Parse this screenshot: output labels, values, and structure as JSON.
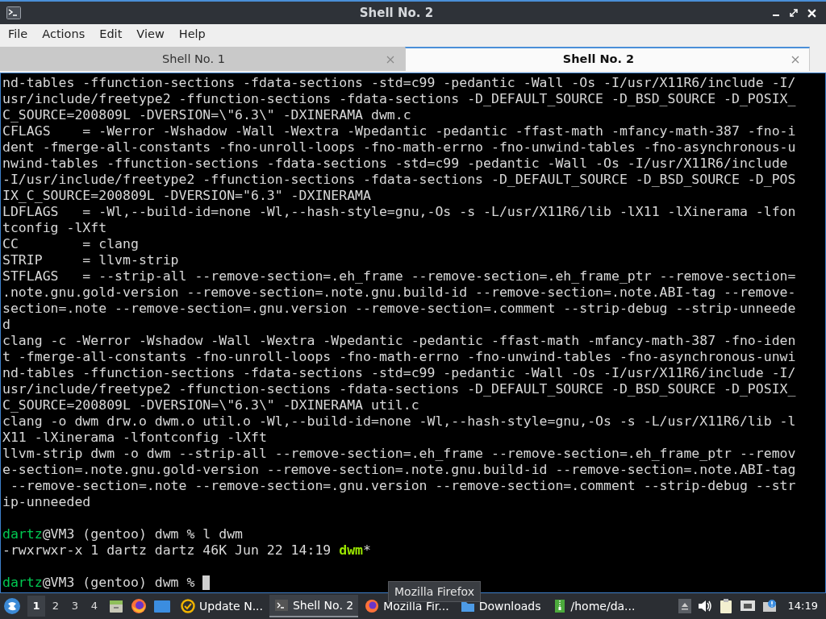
{
  "window": {
    "title": "Shell No. 2"
  },
  "menu": [
    "File",
    "Actions",
    "Edit",
    "View",
    "Help"
  ],
  "tabs": [
    {
      "label": "Shell No. 1",
      "selected": false
    },
    {
      "label": "Shell No. 2",
      "selected": true
    }
  ],
  "terminal": {
    "lines": [
      {
        "kind": "text",
        "segments": [
          {
            "kind": "plain",
            "text": "nd-tables -ffunction-sections -fdata-sections -std=c99 -pedantic -Wall -Os -I/usr/X11R6/include -I/"
          }
        ]
      },
      {
        "kind": "text",
        "segments": [
          {
            "kind": "plain",
            "text": "usr/include/freetype2 -ffunction-sections -fdata-sections -D_DEFAULT_SOURCE -D_BSD_SOURCE -D_POSIX_"
          }
        ]
      },
      {
        "kind": "text",
        "segments": [
          {
            "kind": "plain",
            "text": "C_SOURCE=200809L -DVERSION=\\\"6.3\\\" -DXINERAMA dwm.c"
          }
        ]
      },
      {
        "kind": "text",
        "segments": [
          {
            "kind": "plain",
            "text": "CFLAGS    = -Werror -Wshadow -Wall -Wextra -Wpedantic -pedantic -ffast-math -mfancy-math-387 -fno-i"
          }
        ]
      },
      {
        "kind": "text",
        "segments": [
          {
            "kind": "plain",
            "text": "dent -fmerge-all-constants -fno-unroll-loops -fno-math-errno -fno-unwind-tables -fno-asynchronous-u"
          }
        ]
      },
      {
        "kind": "text",
        "segments": [
          {
            "kind": "plain",
            "text": "nwind-tables -ffunction-sections -fdata-sections -std=c99 -pedantic -Wall -Os -I/usr/X11R6/include"
          }
        ]
      },
      {
        "kind": "text",
        "segments": [
          {
            "kind": "plain",
            "text": "-I/usr/include/freetype2 -ffunction-sections -fdata-sections -D_DEFAULT_SOURCE -D_BSD_SOURCE -D_POS"
          }
        ]
      },
      {
        "kind": "text",
        "segments": [
          {
            "kind": "plain",
            "text": "IX_C_SOURCE=200809L -DVERSION=\"6.3\" -DXINERAMA"
          }
        ]
      },
      {
        "kind": "text",
        "segments": [
          {
            "kind": "plain",
            "text": "LDFLAGS   = -Wl,--build-id=none -Wl,--hash-style=gnu,-Os -s -L/usr/X11R6/lib -lX11 -lXinerama -lfon"
          }
        ]
      },
      {
        "kind": "text",
        "segments": [
          {
            "kind": "plain",
            "text": "tconfig -lXft"
          }
        ]
      },
      {
        "kind": "text",
        "segments": [
          {
            "kind": "plain",
            "text": "CC        = clang"
          }
        ]
      },
      {
        "kind": "text",
        "segments": [
          {
            "kind": "plain",
            "text": "STRIP     = llvm-strip"
          }
        ]
      },
      {
        "kind": "text",
        "segments": [
          {
            "kind": "plain",
            "text": "STFLAGS   = --strip-all --remove-section=.eh_frame --remove-section=.eh_frame_ptr --remove-section="
          }
        ]
      },
      {
        "kind": "text",
        "segments": [
          {
            "kind": "plain",
            "text": ".note.gnu.gold-version --remove-section=.note.gnu.build-id --remove-section=.note.ABI-tag --remove-"
          }
        ]
      },
      {
        "kind": "text",
        "segments": [
          {
            "kind": "plain",
            "text": "section=.note --remove-section=.gnu.version --remove-section=.comment --strip-debug --strip-unneede"
          }
        ]
      },
      {
        "kind": "text",
        "segments": [
          {
            "kind": "plain",
            "text": "d"
          }
        ]
      },
      {
        "kind": "text",
        "segments": [
          {
            "kind": "plain",
            "text": "clang -c -Werror -Wshadow -Wall -Wextra -Wpedantic -pedantic -ffast-math -mfancy-math-387 -fno-iden"
          }
        ]
      },
      {
        "kind": "text",
        "segments": [
          {
            "kind": "plain",
            "text": "t -fmerge-all-constants -fno-unroll-loops -fno-math-errno -fno-unwind-tables -fno-asynchronous-unwi"
          }
        ]
      },
      {
        "kind": "text",
        "segments": [
          {
            "kind": "plain",
            "text": "nd-tables -ffunction-sections -fdata-sections -std=c99 -pedantic -Wall -Os -I/usr/X11R6/include -I/"
          }
        ]
      },
      {
        "kind": "text",
        "segments": [
          {
            "kind": "plain",
            "text": "usr/include/freetype2 -ffunction-sections -fdata-sections -D_DEFAULT_SOURCE -D_BSD_SOURCE -D_POSIX_"
          }
        ]
      },
      {
        "kind": "text",
        "segments": [
          {
            "kind": "plain",
            "text": "C_SOURCE=200809L -DVERSION=\\\"6.3\\\" -DXINERAMA util.c"
          }
        ]
      },
      {
        "kind": "text",
        "segments": [
          {
            "kind": "plain",
            "text": "clang -o dwm drw.o dwm.o util.o -Wl,--build-id=none -Wl,--hash-style=gnu,-Os -s -L/usr/X11R6/lib -l"
          }
        ]
      },
      {
        "kind": "text",
        "segments": [
          {
            "kind": "plain",
            "text": "X11 -lXinerama -lfontconfig -lXft"
          }
        ]
      },
      {
        "kind": "text",
        "segments": [
          {
            "kind": "plain",
            "text": "llvm-strip dwm -o dwm --strip-all --remove-section=.eh_frame --remove-section=.eh_frame_ptr --remov"
          }
        ]
      },
      {
        "kind": "text",
        "segments": [
          {
            "kind": "plain",
            "text": "e-section=.note.gnu.gold-version --remove-section=.note.gnu.build-id --remove-section=.note.ABI-tag"
          }
        ]
      },
      {
        "kind": "text",
        "segments": [
          {
            "kind": "plain",
            "text": " --remove-section=.note --remove-section=.gnu.version --remove-section=.comment --strip-debug --str"
          }
        ]
      },
      {
        "kind": "text",
        "segments": [
          {
            "kind": "plain",
            "text": "ip-unneeded"
          }
        ]
      },
      {
        "kind": "blank"
      },
      {
        "kind": "text",
        "segments": [
          {
            "kind": "user",
            "text": "dartz"
          },
          {
            "kind": "plain",
            "text": "@VM3 (gentoo) dwm % l dwm"
          }
        ]
      },
      {
        "kind": "text",
        "segments": [
          {
            "kind": "plain",
            "text": "-rwxrwxr-x 1 dartz dartz 46K Jun 22 14:19 "
          },
          {
            "kind": "exec",
            "text": "dwm"
          },
          {
            "kind": "plain",
            "text": "*"
          }
        ]
      },
      {
        "kind": "blank"
      },
      {
        "kind": "prompt",
        "segments": [
          {
            "kind": "user",
            "text": "dartz"
          },
          {
            "kind": "plain",
            "text": "@VM3 (gentoo) dwm % "
          }
        ]
      }
    ]
  },
  "tooltip": "Mozilla Firefox",
  "taskbar": {
    "workspaces": [
      {
        "label": "1",
        "selected": true
      },
      {
        "label": "2",
        "selected": false
      },
      {
        "label": "3",
        "selected": false
      },
      {
        "label": "4",
        "selected": false
      }
    ],
    "tasks": [
      {
        "kind": "update",
        "label": "Update N...",
        "selected": false
      },
      {
        "kind": "terminal",
        "label": "Shell No. 2",
        "selected": true
      },
      {
        "kind": "firefox",
        "label": "Mozilla Fir...",
        "selected": false
      },
      {
        "kind": "folder",
        "label": "Downloads",
        "selected": false
      },
      {
        "kind": "archive",
        "label": "/home/da...",
        "selected": false
      }
    ],
    "clock": "14:19"
  }
}
